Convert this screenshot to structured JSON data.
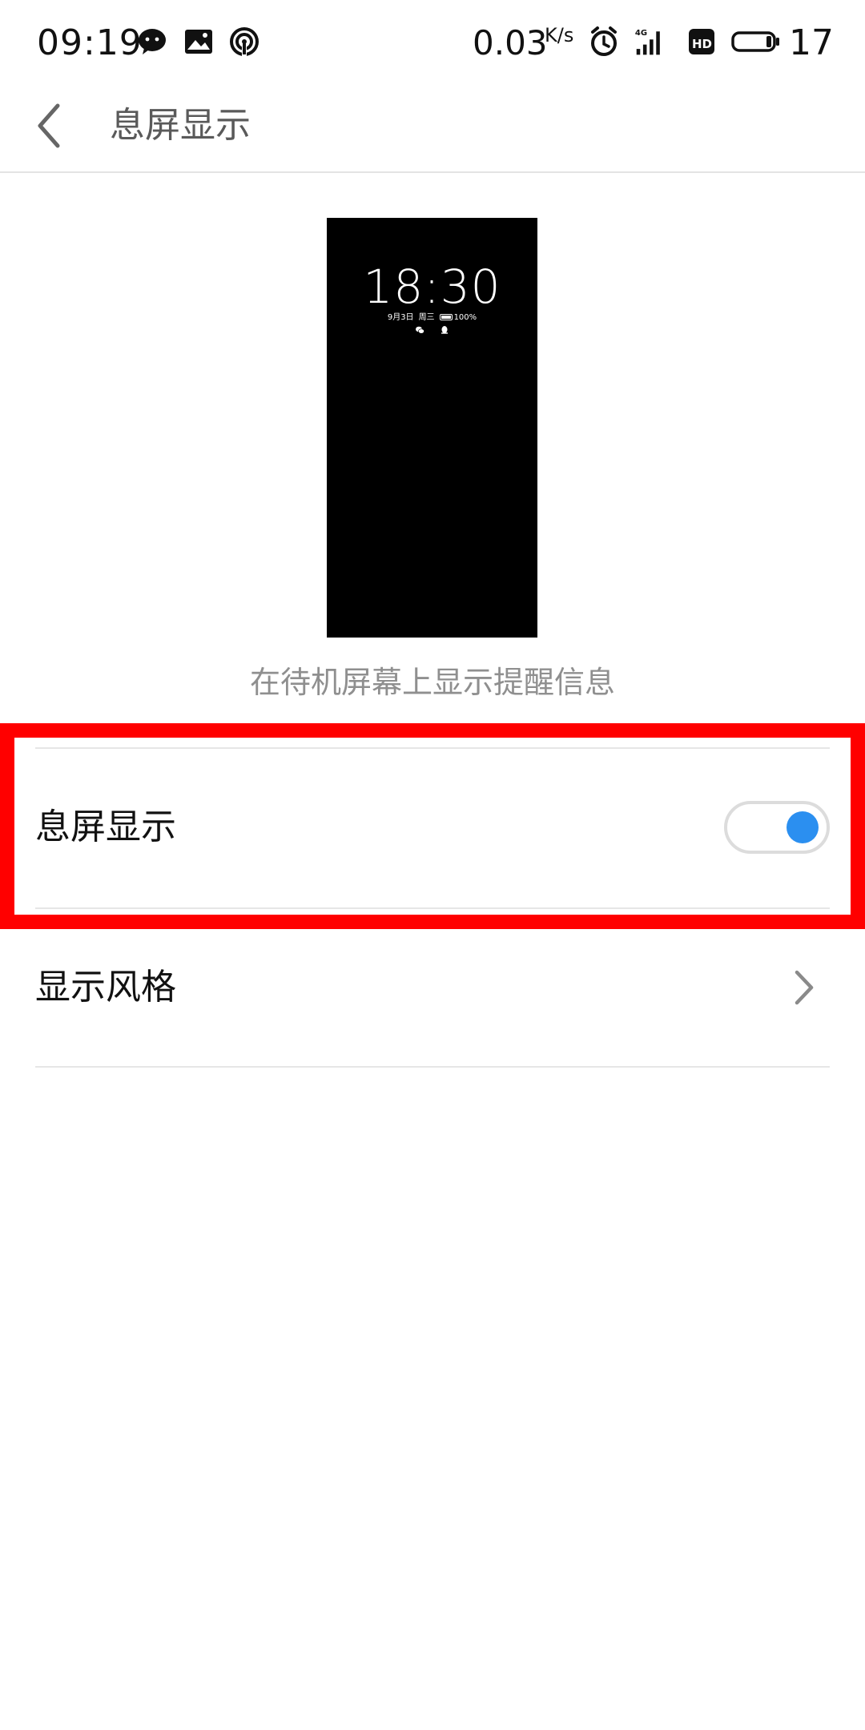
{
  "status_bar": {
    "time": "09:19",
    "net_speed": "0.03",
    "net_speed_unit": "K/s",
    "battery_level": "17",
    "icons": [
      "wechat-icon",
      "gallery-icon",
      "hotspot-icon",
      "alarm-icon",
      "signal-4g-icon",
      "hd-icon",
      "battery-icon"
    ]
  },
  "header": {
    "title": "息屏显示"
  },
  "preview": {
    "time": "18:30",
    "date": "9月3日",
    "weekday": "周三",
    "battery": "100%",
    "caption": "在待机屏幕上显示提醒信息"
  },
  "settings": {
    "aod_toggle": {
      "label": "息屏显示",
      "state": "on",
      "accent_color": "#2b8ff0"
    },
    "display_style": {
      "label": "显示风格"
    }
  },
  "highlight_color": "#ff0000"
}
